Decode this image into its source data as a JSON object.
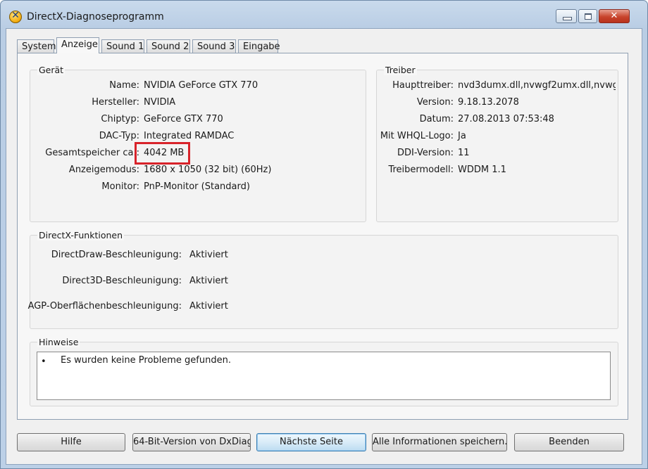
{
  "window": {
    "title": "DirectX-Diagnoseprogramm"
  },
  "tabs": [
    "System",
    "Anzeige",
    "Sound 1",
    "Sound 2",
    "Sound 3",
    "Eingabe"
  ],
  "active_tab": "Anzeige",
  "device": {
    "title": "Gerät",
    "rows": [
      {
        "label": "Name:",
        "value": "NVIDIA GeForce GTX 770"
      },
      {
        "label": "Hersteller:",
        "value": "NVIDIA"
      },
      {
        "label": "Chiptyp:",
        "value": "GeForce GTX 770"
      },
      {
        "label": "DAC-Typ:",
        "value": "Integrated RAMDAC"
      },
      {
        "label": "Gesamtspeicher ca.:",
        "value": "4042 MB"
      },
      {
        "label": "Anzeigemodus:",
        "value": "1680 x 1050 (32 bit) (60Hz)"
      },
      {
        "label": "Monitor:",
        "value": "PnP-Monitor (Standard)"
      }
    ]
  },
  "driver": {
    "title": "Treiber",
    "rows": [
      {
        "label": "Haupttreiber:",
        "value": "nvd3dumx.dll,nvwgf2umx.dll,nvwgf2"
      },
      {
        "label": "Version:",
        "value": "9.18.13.2078"
      },
      {
        "label": "Datum:",
        "value": "27.08.2013 07:53:48"
      },
      {
        "label": "Mit WHQL-Logo:",
        "value": "Ja"
      },
      {
        "label": "DDI-Version:",
        "value": "11"
      },
      {
        "label": "Treibermodell:",
        "value": "WDDM 1.1"
      }
    ]
  },
  "features": {
    "title": "DirectX-Funktionen",
    "rows": [
      {
        "label": "DirectDraw-Beschleunigung:",
        "value": "Aktiviert"
      },
      {
        "label": "Direct3D-Beschleunigung:",
        "value": "Aktiviert"
      },
      {
        "label": "AGP-Oberflächenbeschleunigung:",
        "value": "Aktiviert"
      }
    ]
  },
  "notes": {
    "title": "Hinweise",
    "bullet": "•",
    "items": [
      "Es wurden keine Probleme gefunden."
    ]
  },
  "buttons": {
    "help": "Hilfe",
    "bit64": "64-Bit-Version von DxDiag",
    "next": "Nächste Seite",
    "save_all": "Alle Informationen speichern...",
    "exit": "Beenden"
  },
  "colors": {
    "highlight_box": "#d8232a",
    "window_frame": "#bcd0e7"
  }
}
